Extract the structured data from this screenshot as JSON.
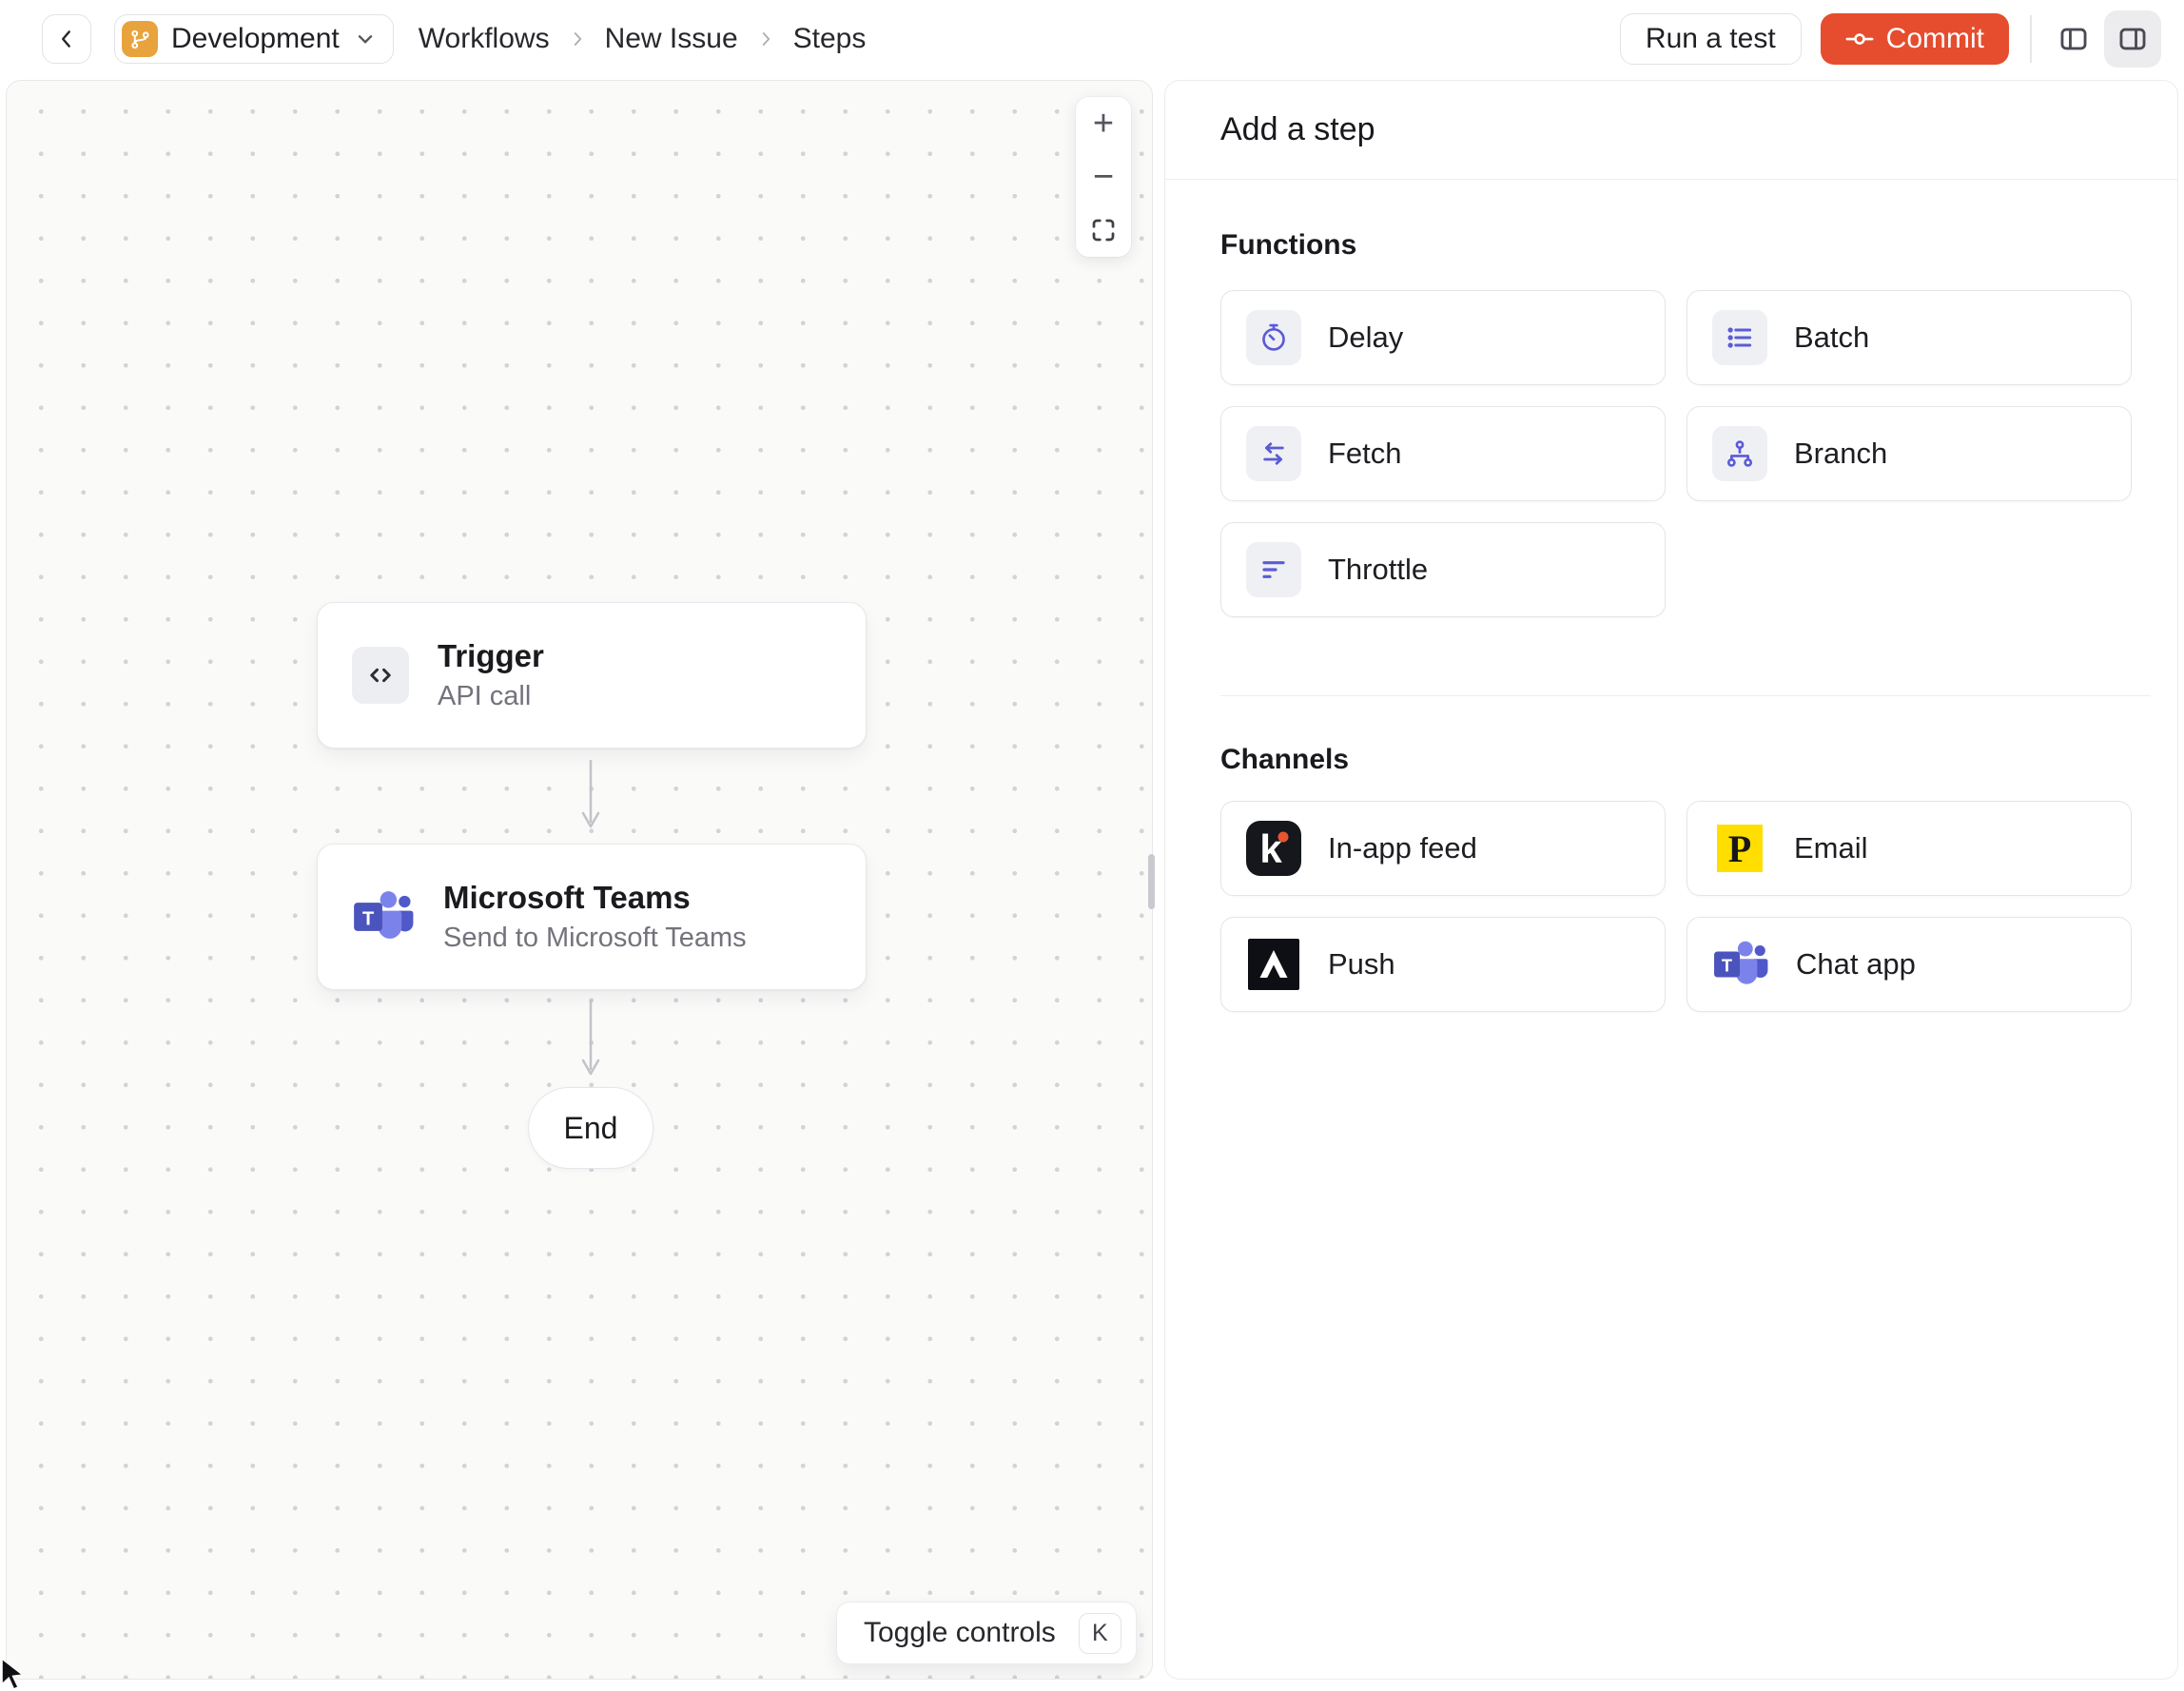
{
  "header": {
    "environment": {
      "label": "Development",
      "icon": "git-branch-icon"
    },
    "breadcrumb": {
      "items": [
        "Workflows",
        "New Issue",
        "Steps"
      ]
    },
    "actions": {
      "run_test_label": "Run a test",
      "commit_label": "Commit",
      "commit_icon": "git-commit-icon"
    }
  },
  "canvas": {
    "zoom_controls": {
      "zoom_in": "+",
      "zoom_out": "−",
      "fit_icon": "fit-view-icon"
    },
    "nodes": {
      "trigger": {
        "title": "Trigger",
        "subtitle": "API call",
        "icon": "code-icon"
      },
      "teams": {
        "title": "Microsoft Teams",
        "subtitle": "Send to Microsoft Teams",
        "icon": "microsoft-teams-icon",
        "logo_letter": "T"
      },
      "end": {
        "label": "End"
      }
    },
    "toggle_controls": {
      "label": "Toggle controls",
      "shortcut_key": "K"
    }
  },
  "panel": {
    "title": "Add a step",
    "functions": {
      "label": "Functions",
      "items": [
        {
          "label": "Delay",
          "icon": "stopwatch-icon"
        },
        {
          "label": "Batch",
          "icon": "list-icon"
        },
        {
          "label": "Fetch",
          "icon": "swap-arrows-icon"
        },
        {
          "label": "Branch",
          "icon": "org-tree-icon"
        },
        {
          "label": "Throttle",
          "icon": "filter-lines-icon"
        }
      ]
    },
    "channels": {
      "label": "Channels",
      "items": [
        {
          "label": "In-app feed",
          "icon": "knock-logo-icon",
          "logo_letter": "k"
        },
        {
          "label": "Email",
          "icon": "postmark-logo-icon",
          "logo_letter": "P"
        },
        {
          "label": "Push",
          "icon": "expo-logo-icon"
        },
        {
          "label": "Chat app",
          "icon": "microsoft-teams-icon",
          "logo_letter": "T"
        }
      ]
    }
  },
  "colors": {
    "accent_commit": "#E54D2E",
    "environment_badge": "#E8A33D",
    "function_icon": "#5B5BD6",
    "knock_dark": "#15171C",
    "knock_dot": "#E8542F",
    "postmark_yellow": "#FFDE00",
    "expo_black": "#0D0F14",
    "teams_purple_dark": "#4B53BC",
    "teams_purple_light": "#7B83EB",
    "canvas_bg": "#FAFAF9"
  }
}
